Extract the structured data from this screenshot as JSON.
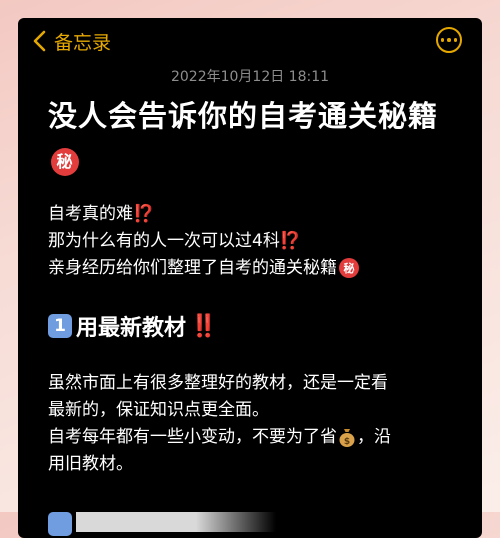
{
  "navbar": {
    "back_label": "备忘录",
    "back_icon": "chevron-left-icon",
    "more_icon": "ellipsis-circle-icon",
    "accent_color": "#e5a800"
  },
  "note": {
    "timestamp": "2022年10月12日 18:11",
    "title": "没人会告诉你的自考通关秘籍",
    "title_emoji": "秘",
    "intro": [
      {
        "text": "自考真的难",
        "mark": "⁉️"
      },
      {
        "text": "那为什么有的人一次可以过4科",
        "mark": "⁉️"
      },
      {
        "text": "亲身经历给你们整理了自考的通关秘籍",
        "emoji": "秘"
      }
    ],
    "section1": {
      "number": "1",
      "title": "用最新教材",
      "mark": "‼️"
    },
    "section1_body": {
      "line1": "虽然市面上有很多整理好的教材，还是一定看",
      "line2": "最新的，保证知识点更全面。",
      "line3a": "自考每年都有一些小变动，不要为了省",
      "line3b": "，沿",
      "line4": "用旧教材。",
      "money_icon": "money-bag-icon"
    }
  }
}
